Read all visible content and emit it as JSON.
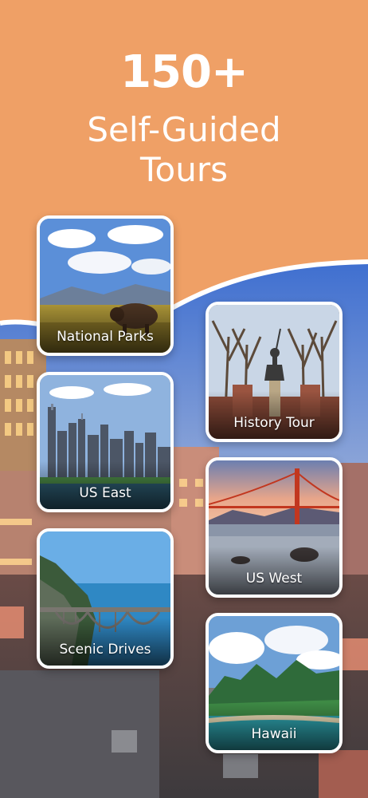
{
  "headline": {
    "count": "150+",
    "line1": "Self-Guided",
    "line2": "Tours"
  },
  "colors": {
    "background": "#EFA066",
    "card_border": "#FFFFFF",
    "text": "#FFFFFF"
  },
  "cards": [
    {
      "label": "National Parks",
      "image": "bison-in-grassland"
    },
    {
      "label": "History Tour",
      "image": "statue-in-tree-lined-square"
    },
    {
      "label": "US East",
      "image": "city-skyline-waterfront"
    },
    {
      "label": "US West",
      "image": "golden-gate-bridge"
    },
    {
      "label": "Scenic Drives",
      "image": "coastal-arch-bridge"
    },
    {
      "label": "Hawaii",
      "image": "tropical-island-mountains"
    }
  ]
}
